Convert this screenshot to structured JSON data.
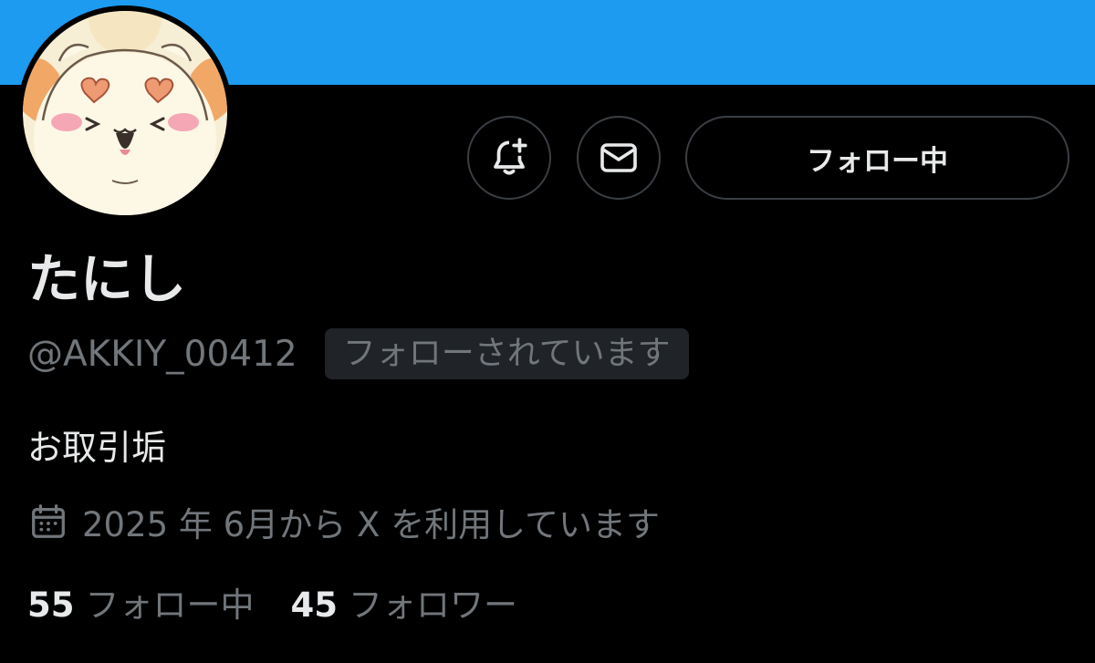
{
  "profile": {
    "display_name": "たにし",
    "handle": "@AKKIY_00412",
    "follows_you_badge": "フォローされています",
    "bio": "お取引垢",
    "joined": "2025 年 6月から X を利用しています",
    "avatar_icon": "hamster-character-avatar"
  },
  "actions": {
    "notify_icon": "bell-plus-icon",
    "message_icon": "envelope-icon",
    "follow_label": "フォロー中"
  },
  "stats": {
    "following_count": "55",
    "following_label": "フォロー中",
    "followers_count": "45",
    "followers_label": "フォロワー"
  },
  "colors": {
    "banner": "#1d9bf0",
    "background": "#000000",
    "primary_text": "#e7e9ea",
    "secondary_text": "#71767b",
    "border": "#3a3f44",
    "badge_bg": "#202327"
  }
}
